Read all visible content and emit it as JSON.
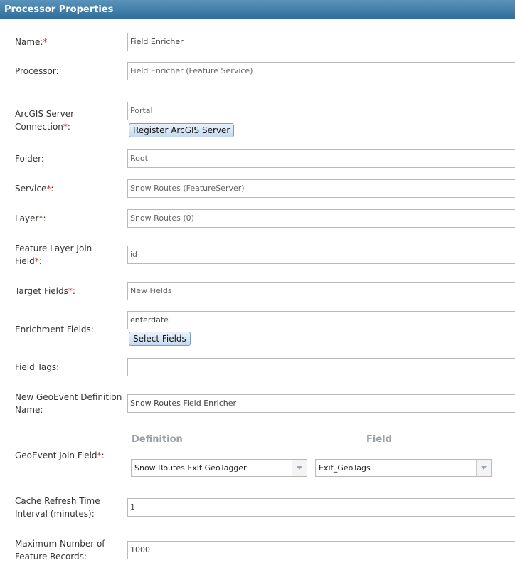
{
  "title": "Processor Properties",
  "required_mark": "*",
  "fields": {
    "name": {
      "label": "Name:",
      "value": "Field Enricher"
    },
    "processor": {
      "label": "Processor:",
      "value": "Field Enricher (Feature Service)"
    },
    "arcgis": {
      "label_line1": "ArcGIS Server",
      "label_line2": "Connection",
      "label_colon": ":",
      "value": "Portal",
      "button": "Register ArcGIS Server"
    },
    "folder": {
      "label": "Folder:",
      "value": "Root"
    },
    "service": {
      "label": "Service",
      "label_colon": ":",
      "value": "Snow Routes (FeatureServer)"
    },
    "layer": {
      "label": "Layer",
      "label_colon": ":",
      "value": "Snow Routes (0)"
    },
    "join_field": {
      "label_line1": "Feature Layer Join",
      "label_line2": "Field",
      "label_colon": ":",
      "value": "id"
    },
    "target_fields": {
      "label": "Target Fields",
      "label_colon": ":",
      "value": "New Fields"
    },
    "enrichment_fields": {
      "label": "Enrichment Fields:",
      "value": "enterdate",
      "button": "Select Fields"
    },
    "field_tags": {
      "label": "Field Tags:",
      "value": ""
    },
    "new_geoevent": {
      "label_line1": "New GeoEvent Definition",
      "label_line2": "Name:",
      "value": "Snow Routes Field Enricher"
    },
    "geoevent_join": {
      "label": "GeoEvent Join Field",
      "label_colon": ":",
      "col_definition": "Definition",
      "col_field": "Field",
      "definition_value": "Snow Routes Exit GeoTagger",
      "field_value": "Exit_GeoTags"
    },
    "cache_refresh": {
      "label_line1": "Cache Refresh Time",
      "label_line2": "Interval (minutes):",
      "value": "1"
    },
    "max_records": {
      "label_line1": "Maximum Number of",
      "label_line2": "Feature Records:",
      "value": "1000"
    }
  },
  "colors": {
    "titlebar": "#3f7fad",
    "required": "#e0261b",
    "column_header": "#9aa0a6"
  }
}
